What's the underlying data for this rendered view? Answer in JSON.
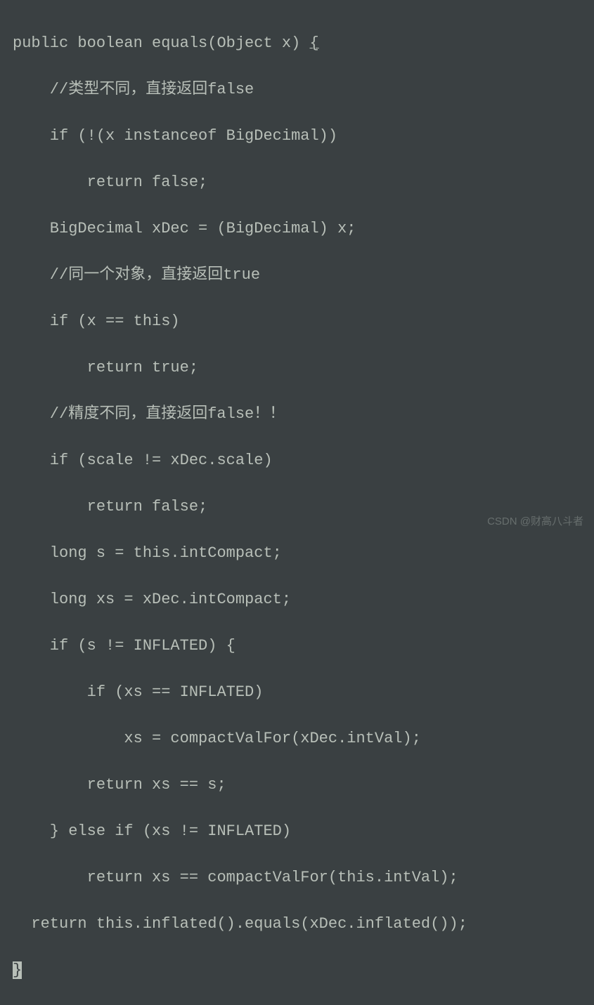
{
  "code": {
    "line1_pre": "public boolean equals(Object x) ",
    "line1_brace": "{",
    "line2": "    //类型不同，直接返回false",
    "line3": "    if (!(x instanceof BigDecimal))",
    "line4": "        return false;",
    "line5": "    BigDecimal xDec = (BigDecimal) x;",
    "line6": "    //同一个对象，直接返回true",
    "line7": "    if (x == this)",
    "line8": "        return true;",
    "line9": "    //精度不同，直接返回false！！",
    "line10": "    if (scale != xDec.scale)",
    "line11": "        return false;",
    "line12": "    long s = this.intCompact;",
    "line13": "    long xs = xDec.intCompact;",
    "line14": "    if (s != INFLATED) {",
    "line15": "        if (xs == INFLATED)",
    "line16": "            xs = compactValFor(xDec.intVal);",
    "line17": "        return xs == s;",
    "line18": "    } else if (xs != INFLATED)",
    "line19": "        return xs == compactValFor(this.intVal);",
    "line20": "  return this.inflated().equals(xDec.inflated());",
    "line21": "}"
  },
  "watermark": "CSDN @财高八斗者"
}
